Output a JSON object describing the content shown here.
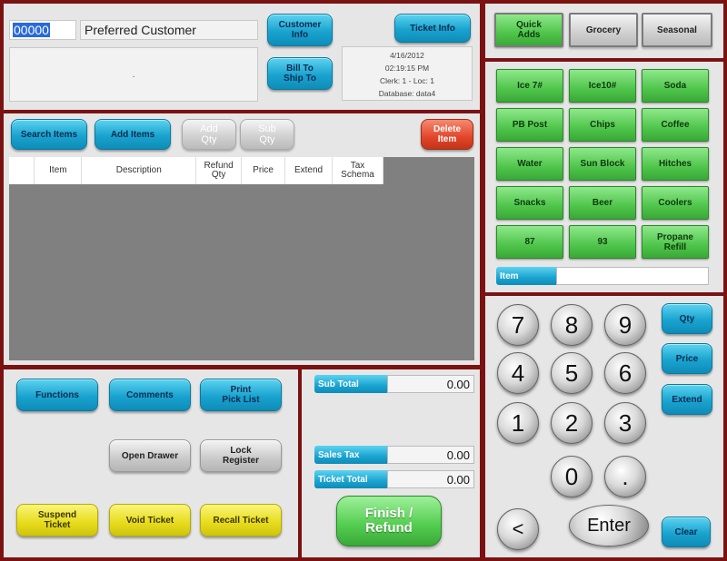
{
  "customer": {
    "id": "00000",
    "name": "Preferred Customer",
    "notes": ".",
    "info_button": "Customer\nInfo",
    "bill_to_ship_to": "Bill To\nShip To",
    "ticket_info_button": "Ticket Info"
  },
  "ticket_info": {
    "date": "4/16/2012",
    "time": "02:19:15 PM",
    "clerk_loc": "Clerk: 1 - Loc: 1",
    "database": "Database: data4"
  },
  "categories": [
    "Quick\nAdds",
    "Grocery",
    "Seasonal"
  ],
  "quick_items": [
    "Ice 7#",
    "Ice10#",
    "Soda",
    "PB Post",
    "Chips",
    "Coffee",
    "Water",
    "Sun Block",
    "Hitches",
    "Snacks",
    "Beer",
    "Coolers",
    "87",
    "93",
    "Propane\nRefill"
  ],
  "item_field": {
    "label": "Item",
    "value": ""
  },
  "items_toolbar": {
    "search": "Search Items",
    "add": "Add Items",
    "add_qty": "Add\nQty",
    "sub_qty": "Sub\nQty",
    "delete": "Delete\nItem"
  },
  "table": {
    "columns": [
      "",
      "Item",
      "Description",
      "Refund\nQty",
      "Price",
      "Extend",
      "Tax\nSchema"
    ],
    "rows": []
  },
  "functions": {
    "functions": "Functions",
    "comments": "Comments",
    "print_pick_list": "Print\nPick List",
    "open_drawer": "Open Drawer",
    "lock_register": "Lock\nRegister",
    "suspend_ticket": "Suspend\nTicket",
    "void_ticket": "Void Ticket",
    "recall_ticket": "Recall Ticket"
  },
  "totals": {
    "sub_total_label": "Sub Total",
    "sub_total": "0.00",
    "sales_tax_label": "Sales Tax",
    "sales_tax": "0.00",
    "ticket_total_label": "Ticket Total",
    "ticket_total": "0.00",
    "finish": "Finish /\nRefund"
  },
  "keypad": {
    "keys": [
      "7",
      "8",
      "9",
      "4",
      "5",
      "6",
      "1",
      "2",
      "3",
      "0",
      "."
    ],
    "back": "<",
    "enter": "Enter",
    "qty": "Qty",
    "price": "Price",
    "extend": "Extend",
    "clear": "Clear"
  },
  "colors": {
    "frame": "#7b1212",
    "accent_blue": "#1aa3cf",
    "accent_green": "#4fc54b",
    "accent_yellow": "#e6db1a",
    "accent_red": "#e2452a"
  }
}
